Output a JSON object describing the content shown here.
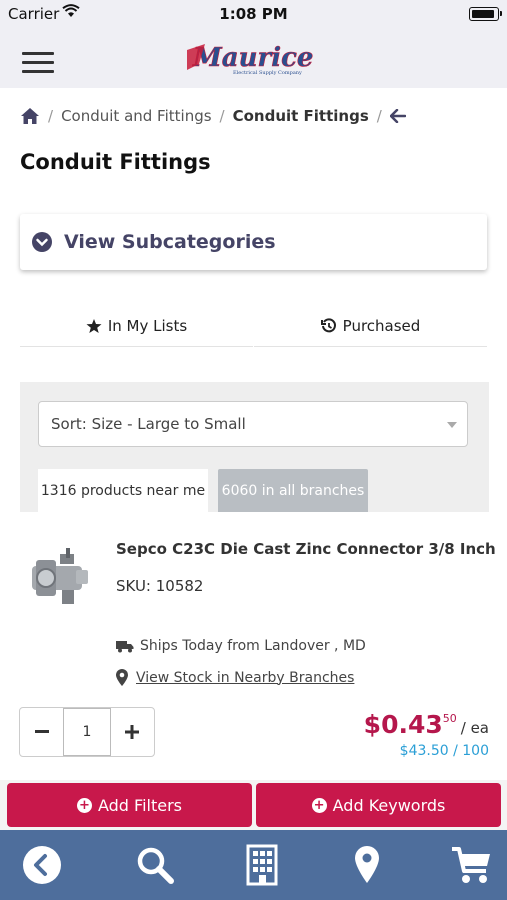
{
  "status_bar": {
    "carrier": "Carrier",
    "time": "1:08 PM"
  },
  "header": {
    "logo_text": "Maurice",
    "logo_subtext": "Electrical Supply Company"
  },
  "breadcrumb": {
    "items": [
      "Conduit and Fittings",
      "Conduit Fittings"
    ],
    "separator": "/"
  },
  "page_title": "Conduit Fittings",
  "subcategories": {
    "label": "View Subcategories"
  },
  "tabs": [
    {
      "label": "In My Lists",
      "icon": "star-icon"
    },
    {
      "label": "Purchased",
      "icon": "history-icon"
    }
  ],
  "filters": {
    "sort_value": "Sort: Size - Large to Small",
    "location_tabs": [
      {
        "label": "1316 products near me",
        "active": true
      },
      {
        "label": "6060 in all branches",
        "active": false
      }
    ]
  },
  "product": {
    "name": "Sepco C23C Die Cast Zinc Connector 3/8 Inch",
    "sku": "SKU: 10582",
    "ships": "Ships Today from Landover , MD",
    "stock_link": "View Stock in Nearby Branches",
    "quantity": "1",
    "price_main": "$0.43",
    "price_cents": "50",
    "price_unit": "/ ea",
    "bulk_price": "$43.50 / 100"
  },
  "actions": {
    "add_filters": "Add Filters",
    "add_keywords": "Add Keywords"
  },
  "colors": {
    "accent": "#c8184b",
    "nav": "#4e6e9c",
    "dark": "#454466",
    "link": "#2b9fd6"
  }
}
